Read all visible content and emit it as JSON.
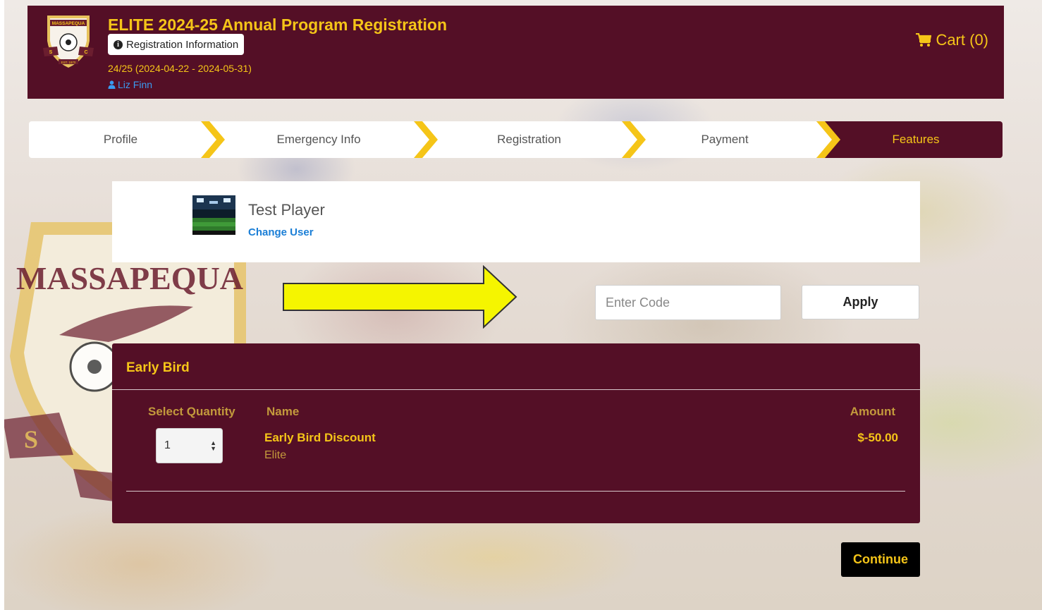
{
  "header": {
    "title": "ELITE 2024-25 Annual Program Registration",
    "registration_info_label": "Registration Information",
    "dates": "24/25 (2024-04-22 - 2024-05-31)",
    "user_name": "Liz Finn",
    "cart_label": "Cart (0)",
    "logo_text": {
      "top": "MASSAPEQUA",
      "left": "S",
      "right": "C",
      "bottom": "EST. 1970"
    }
  },
  "steps": [
    {
      "label": "Profile",
      "active": false
    },
    {
      "label": "Emergency Info",
      "active": false
    },
    {
      "label": "Registration",
      "active": false
    },
    {
      "label": "Payment",
      "active": false
    },
    {
      "label": "Features",
      "active": true
    }
  ],
  "player": {
    "name": "Test Player",
    "change_user_label": "Change User"
  },
  "code": {
    "placeholder": "Enter Code",
    "apply_label": "Apply"
  },
  "panel": {
    "title": "Early Bird",
    "columns": {
      "quantity": "Select Quantity",
      "name": "Name",
      "amount": "Amount"
    },
    "item": {
      "quantity": "1",
      "name": "Early Bird Discount",
      "subtitle": "Elite",
      "amount": "$-50.00"
    }
  },
  "background_crest_text": "MASSAPEQUA",
  "continue_label": "Continue",
  "colors": {
    "maroon": "#540f26",
    "gold": "#f5c518",
    "muted_gold": "#c39a3c",
    "link_blue": "#1a7ed6",
    "arrow_yellow": "#f5f500"
  }
}
